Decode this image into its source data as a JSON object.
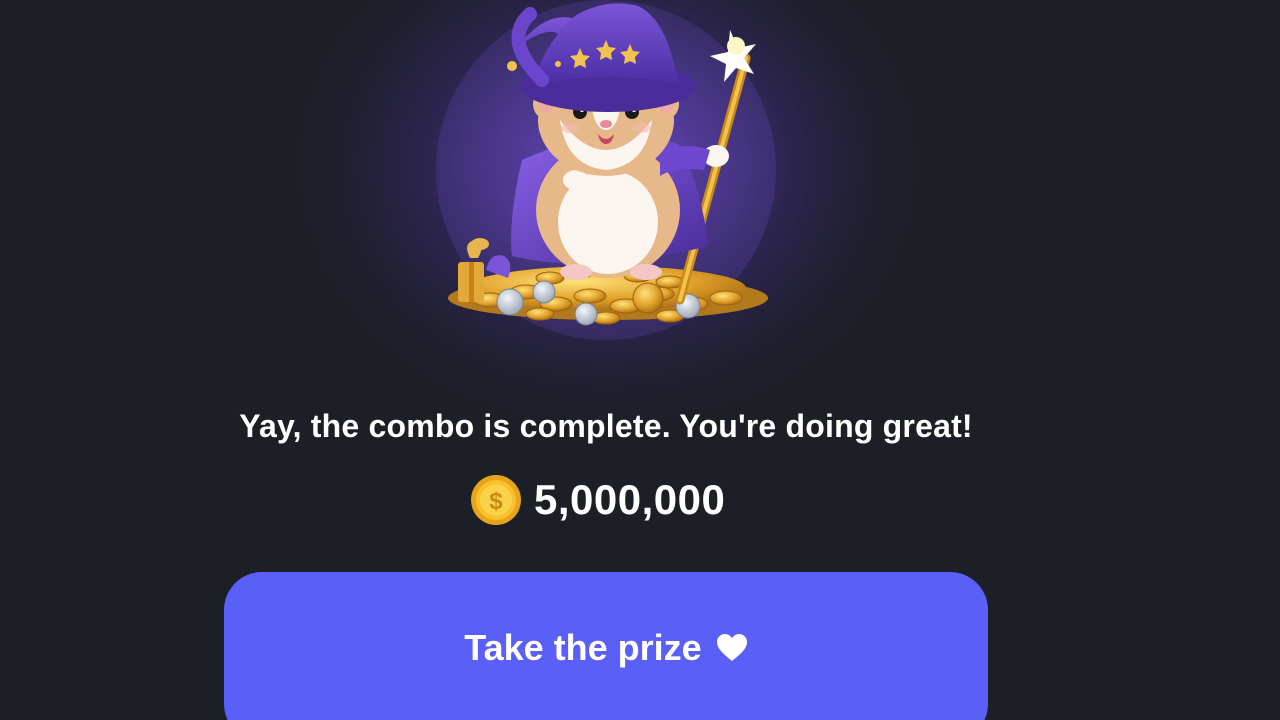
{
  "reward_screen": {
    "message": "Yay, the combo is complete. You're doing great!",
    "reward_amount": "5,000,000",
    "coin_symbol": "$",
    "coin_icon": "gold-coin-icon",
    "button_label": "Take the prize",
    "button_icon": "heart-icon",
    "mascot": "hamster-wizard-illustration"
  },
  "colors": {
    "background": "#1c1f26",
    "button": "#5a5ff7",
    "text": "#ffffff",
    "glow": "#7c54e6",
    "coin": "#f6c12a"
  }
}
